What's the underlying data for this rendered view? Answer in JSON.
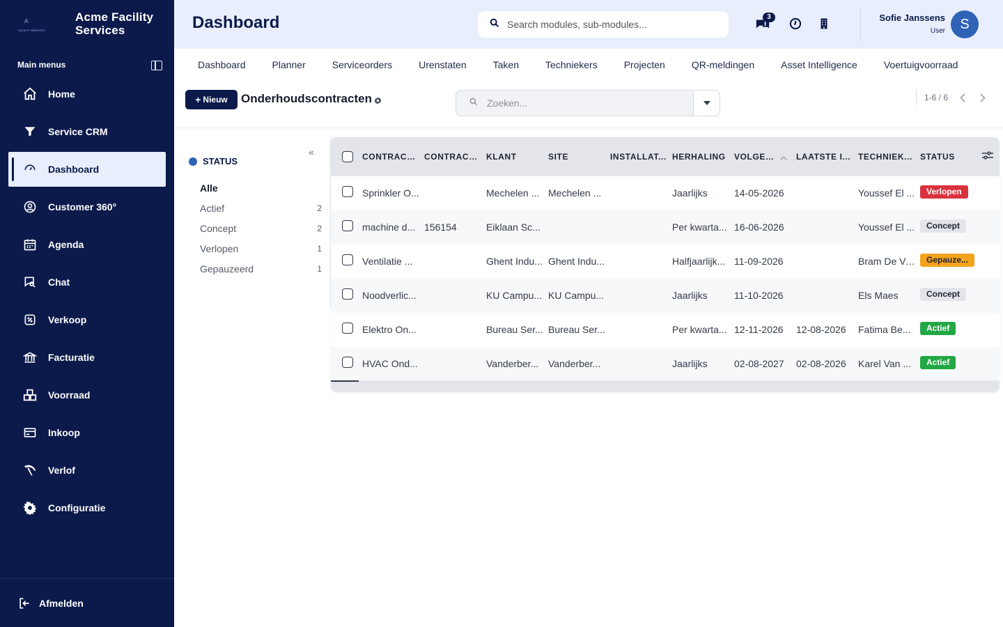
{
  "brand": {
    "name": "Acme Facility Services",
    "logo_text": "FACILITY SERVICES",
    "logo_letter": "A"
  },
  "sidebar": {
    "heading": "Main menus",
    "items": [
      {
        "label": "Home",
        "icon": "home-icon"
      },
      {
        "label": "Service CRM",
        "icon": "funnel-icon"
      },
      {
        "label": "Dashboard",
        "icon": "gauge-icon",
        "active": true
      },
      {
        "label": "Customer 360°",
        "icon": "user-circle-icon"
      },
      {
        "label": "Agenda",
        "icon": "calendar-icon"
      },
      {
        "label": "Chat",
        "icon": "chat-search-icon"
      },
      {
        "label": "Verkoop",
        "icon": "sale-icon"
      },
      {
        "label": "Facturatie",
        "icon": "bank-icon"
      },
      {
        "label": "Voorraad",
        "icon": "warehouse-icon"
      },
      {
        "label": "Inkoop",
        "icon": "card-icon"
      },
      {
        "label": "Verlof",
        "icon": "leave-icon"
      },
      {
        "label": "Configuratie",
        "icon": "gear-icon"
      }
    ],
    "logout_label": "Afmelden"
  },
  "header": {
    "title": "Dashboard",
    "search_placeholder": "Search modules, sub-modules...",
    "chat_badge": "3",
    "user_name": "Sofie Janssens",
    "user_role": "User",
    "avatar_letter": "S"
  },
  "tabs": [
    "Dashboard",
    "Planner",
    "Serviceorders",
    "Urenstaten",
    "Taken",
    "Techniekers",
    "Projecten",
    "QR-meldingen",
    "Asset Intelligence",
    "Voertuigvoorraad"
  ],
  "toolbar": {
    "new_label": "Nieuw",
    "list_title": "Onderhoudscontracten",
    "search_placeholder": "Zoeken...",
    "pager": "1-6 / 6"
  },
  "filters": {
    "title": "STATUS",
    "items": [
      {
        "label": "Alle",
        "count": "",
        "active": true
      },
      {
        "label": "Actief",
        "count": "2"
      },
      {
        "label": "Concept",
        "count": "2"
      },
      {
        "label": "Verlopen",
        "count": "1"
      },
      {
        "label": "Gepauzeerd",
        "count": "1"
      }
    ]
  },
  "table": {
    "columns": [
      "CONTRACT...",
      "CONTRACT...",
      "KLANT",
      "SITE",
      "INSTALLAT...",
      "HERHALING",
      "VOLGEND.",
      "LAATSTE I...",
      "TECHNIEK...",
      "STATUS"
    ],
    "rows": [
      {
        "contract": "Sprinkler O...",
        "number": "",
        "klant": "Mechelen ...",
        "site": "Mechelen ...",
        "installatie": "",
        "herhaling": "Jaarlijks",
        "volgend": "14-05-2026",
        "laatste": "",
        "technieker": "Youssef El ...",
        "status": "Verlopen"
      },
      {
        "contract": "machine d...",
        "number": "156154",
        "klant": "Eiklaan Sc...",
        "site": "",
        "installatie": "",
        "herhaling": "Per kwarta...",
        "volgend": "16-06-2026",
        "laatste": "",
        "technieker": "Youssef El ...",
        "status": "Concept"
      },
      {
        "contract": "Ventilatie ...",
        "number": "",
        "klant": "Ghent Indu...",
        "site": "Ghent Indu...",
        "installatie": "",
        "herhaling": "Halfjaarlijk...",
        "volgend": "11-09-2026",
        "laatste": "",
        "technieker": "Bram De Vos",
        "status": "Gepauze..."
      },
      {
        "contract": "Noodverlic...",
        "number": "",
        "klant": "KU Campu...",
        "site": "KU Campu...",
        "installatie": "",
        "herhaling": "Jaarlijks",
        "volgend": "11-10-2026",
        "laatste": "",
        "technieker": "Els Maes",
        "status": "Concept"
      },
      {
        "contract": "Elektro On...",
        "number": "",
        "klant": "Bureau Ser...",
        "site": "Bureau Ser...",
        "installatie": "",
        "herhaling": "Per kwarta...",
        "volgend": "12-11-2026",
        "laatste": "12-08-2026",
        "technieker": "Fatima Be...",
        "status": "Actief"
      },
      {
        "contract": "HVAC Ond...",
        "number": "",
        "klant": "Vanderber...",
        "site": "Vanderber...",
        "installatie": "",
        "herhaling": "Jaarlijks",
        "volgend": "02-08-2027",
        "laatste": "02-08-2026",
        "technieker": "Karel Van ...",
        "status": "Actief"
      }
    ]
  },
  "status_colors": {
    "Verlopen": {
      "bg": "#d9323d",
      "fg": "#ffffff"
    },
    "Concept": {
      "bg": "#e3e5ea",
      "fg": "#1f2430"
    },
    "Gepauze...": {
      "bg": "#f4a31c",
      "fg": "#1f2430"
    },
    "Actief": {
      "bg": "#22a745",
      "fg": "#ffffff"
    }
  },
  "colors": {
    "sidebar": "#0b1a4a",
    "header": "#e8eefb",
    "accent": "#2f63b8"
  }
}
